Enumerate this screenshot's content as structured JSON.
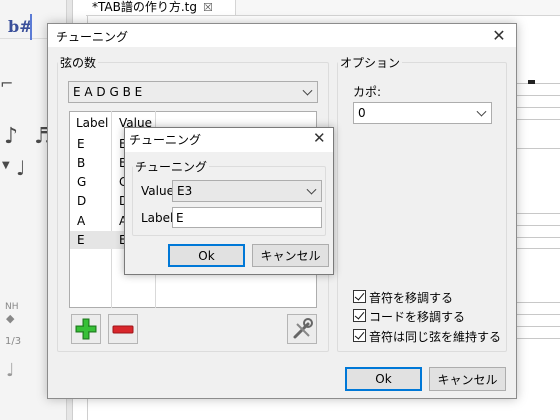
{
  "background": {
    "tab_title": "*TAB譜の作り方.tg",
    "tab_close": "☒",
    "toolbar_symbol": "b#",
    "side_labels": [
      "NH",
      "1/3"
    ]
  },
  "dialog": {
    "title": "チューニング",
    "close": "✕",
    "strings_group": "弦の数",
    "preset_value": "E A D G B E",
    "table": {
      "columns": [
        "Label",
        "Value"
      ],
      "rows": [
        {
          "label": "E",
          "value": "E"
        },
        {
          "label": "B",
          "value": "B"
        },
        {
          "label": "G",
          "value": "G"
        },
        {
          "label": "D",
          "value": "D"
        },
        {
          "label": "A",
          "value": "A"
        },
        {
          "label": "E",
          "value": "E"
        }
      ],
      "selected_row": 5
    },
    "options_group": "オプション",
    "capo_label": "カポ:",
    "capo_value": "0",
    "checkboxes": [
      {
        "label": "音符を移調する",
        "checked": true
      },
      {
        "label": "コードを移調する",
        "checked": true
      },
      {
        "label": "音符は同じ弦を維持する",
        "checked": true
      }
    ],
    "ok": "Ok",
    "cancel": "キャンセル"
  },
  "sub_dialog": {
    "title": "チューニング",
    "close": "✕",
    "group": "チューニング",
    "value_label": "Value",
    "value": "E3",
    "label_label": "Label",
    "label_value": "E",
    "ok": "Ok",
    "cancel": "キャンセル"
  },
  "colors": {
    "accent": "#0078d7",
    "add_icon": "#2ea82e",
    "remove_icon": "#d8262b"
  },
  "icons": [
    "add-string-icon",
    "remove-string-icon",
    "tools-icon",
    "chevron-down-icon",
    "close-icon"
  ]
}
